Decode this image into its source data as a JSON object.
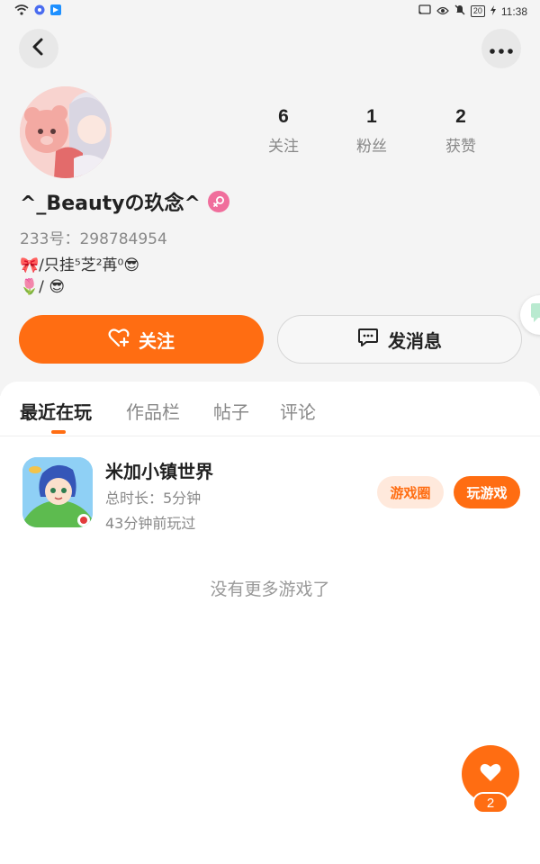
{
  "status_bar": {
    "time": "11:38",
    "battery": "20"
  },
  "profile": {
    "name": "^_Beautyの玖念^",
    "id_label": "233号：298784954",
    "bio_line1": "/只挂⁵芝²苒⁰",
    "bio_line2": "/",
    "bio_emoji_ribbon": "🎀",
    "bio_emoji_tulip": "🌷",
    "bio_emoji_cool": "😎"
  },
  "stats": [
    {
      "value": "6",
      "label": "关注"
    },
    {
      "value": "1",
      "label": "粉丝"
    },
    {
      "value": "2",
      "label": "获赞"
    }
  ],
  "actions": {
    "follow_label": "关注",
    "message_label": "发消息"
  },
  "tabs": [
    {
      "label": "最近在玩",
      "active": true
    },
    {
      "label": "作品栏",
      "active": false
    },
    {
      "label": "帖子",
      "active": false
    },
    {
      "label": "评论",
      "active": false
    }
  ],
  "game": {
    "title": "米加小镇世界",
    "duration": "总时长：5分钟",
    "last_played": "43分钟前玩过",
    "circle_label": "游戏圈",
    "play_label": "玩游戏"
  },
  "empty_text": "没有更多游戏了",
  "fab": {
    "count": "2"
  },
  "colors": {
    "accent": "#ff6d12",
    "female_badge": "#f06e9c"
  }
}
